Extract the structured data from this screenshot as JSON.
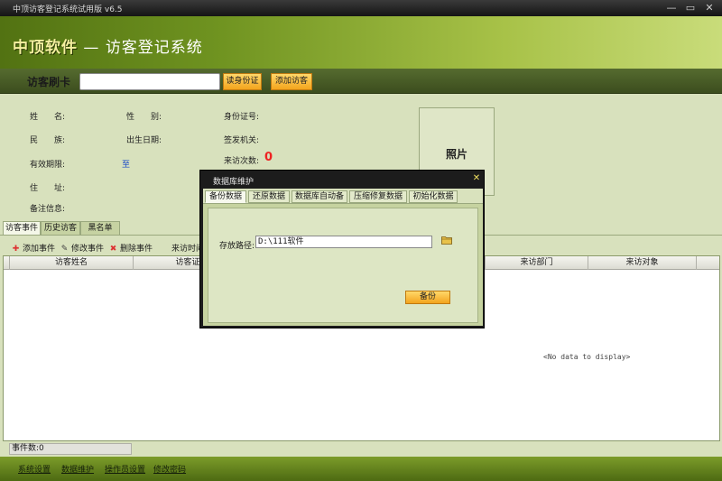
{
  "window": {
    "title": "中顶访客登记系统试用版 v6.5",
    "min_glyph": "—",
    "max_glyph": "▭",
    "close_glyph": "✕"
  },
  "header": {
    "brand": "中顶软件",
    "sep": "—",
    "system": "访客登记系统"
  },
  "card_bar": {
    "label": "访客刷卡",
    "input_value": "",
    "read_id_button": "读身份证",
    "add_visitor_button": "添加访客"
  },
  "info": {
    "name": "姓　　名:",
    "gender": "性　　别:",
    "id_number": "身份证号:",
    "ethnicity": "民　　族:",
    "birth_date": "出生日期:",
    "issuer": "签发机关:",
    "valid_period": "有效期限:",
    "valid_to": "至",
    "visit_count_label": "来访次数:",
    "visit_count": "0",
    "address": "住　　址:",
    "remarks": "备注信息:",
    "photo": "照片"
  },
  "tabs": [
    "访客事件",
    "历史访客",
    "黑名单"
  ],
  "toolbar": {
    "add": "添加事件",
    "edit": "修改事件",
    "delete": "删除事件",
    "visit_time": "来访时间"
  },
  "table": {
    "columns": [
      "访客姓名",
      "访客证件",
      "来访部门",
      "来访对象"
    ],
    "empty_text": "<No data to display>"
  },
  "status": {
    "event_count": "事件数:0"
  },
  "footer": [
    "系统设置",
    "数据维护",
    "操作员设置",
    "修改密码"
  ],
  "dialog": {
    "title": "数据库维护",
    "close_glyph": "✕",
    "tabs": [
      "备份数据库",
      "还原数据库",
      "数据库自动备份",
      "压缩修复数据库",
      "初始化数据库"
    ],
    "path_label": "存放路径:",
    "path_value": "D:\\111软件",
    "backup_button": "备份"
  },
  "colors": {
    "accent_orange": "#f3a41d",
    "panel_green": "#d8e1bd",
    "red_count": "#ee2222",
    "blue_link": "#1646c8"
  }
}
